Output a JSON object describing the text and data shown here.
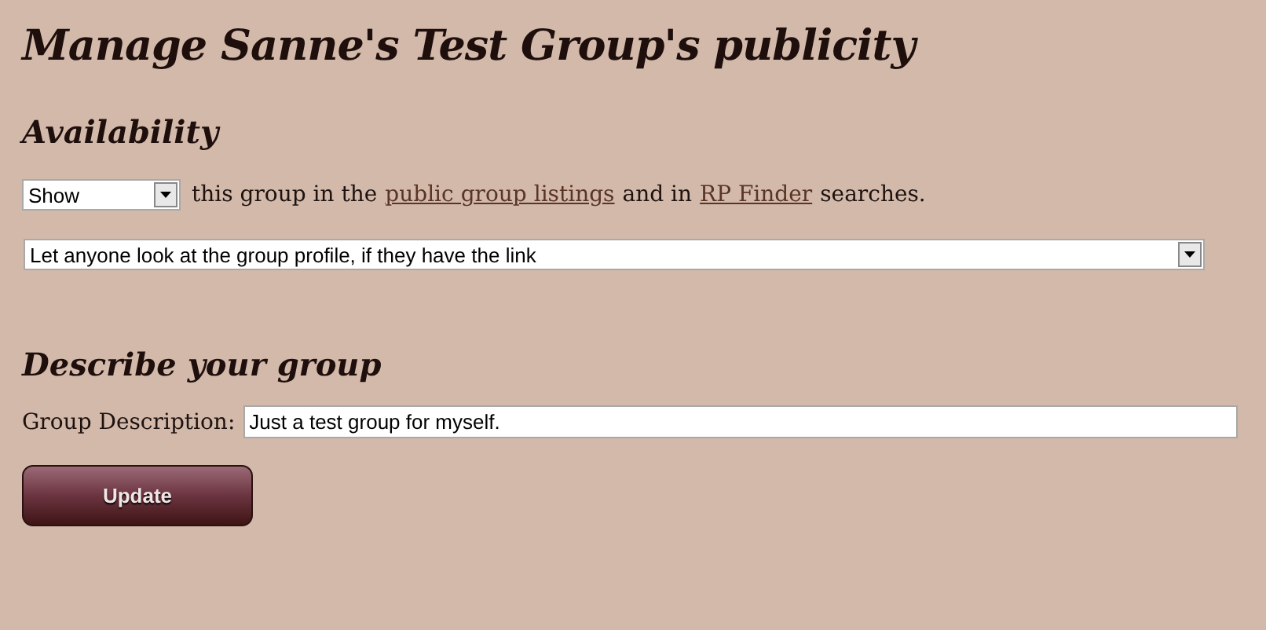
{
  "title": "Manage Sanne's Test Group's publicity",
  "availability": {
    "heading": "Availability",
    "listing_select": {
      "value": "Show"
    },
    "sentence": [
      {
        "kind": "text",
        "text": "this group in the"
      },
      {
        "kind": "link",
        "text": "public group listings"
      },
      {
        "kind": "text",
        "text": "and in"
      },
      {
        "kind": "link",
        "text": "RP Finder"
      },
      {
        "kind": "text",
        "text": "searches."
      }
    ],
    "profile_select": {
      "value": "Let anyone look at the group profile, if they have the link"
    }
  },
  "description": {
    "heading": "Describe your group",
    "label": "Group Description:",
    "value": "Just a test group for myself."
  },
  "update_button": {
    "label": "Update"
  }
}
